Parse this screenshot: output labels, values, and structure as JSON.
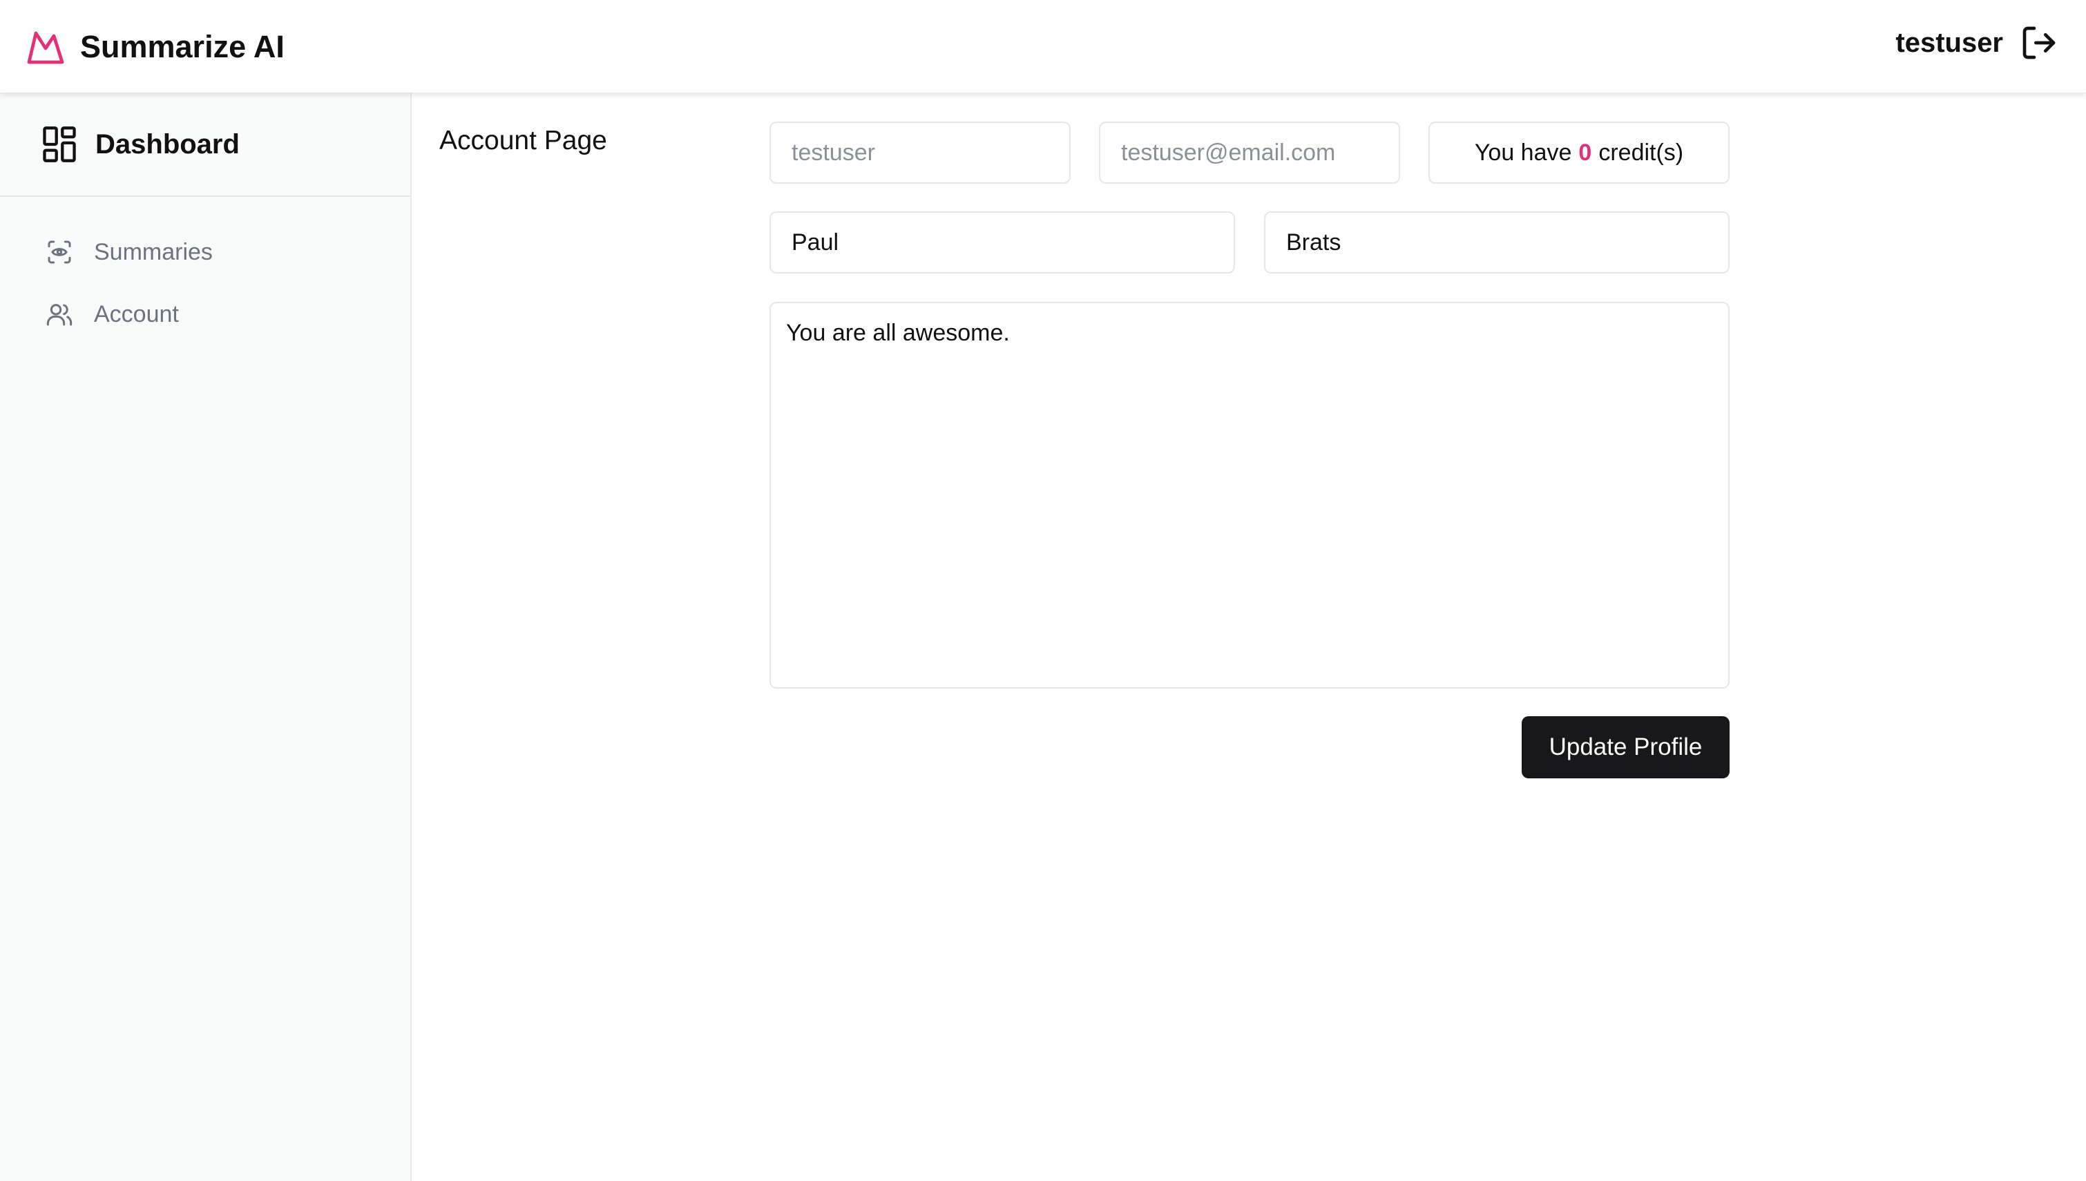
{
  "app": {
    "title": "Summarize AI",
    "brand_color": "#e3307a"
  },
  "header": {
    "username": "testuser",
    "logout_icon": "logout-icon"
  },
  "sidebar": {
    "dashboard_label": "Dashboard",
    "dashboard_icon": "dashboard-grid-icon",
    "items": [
      {
        "label": "Summaries",
        "icon": "eye-icon"
      },
      {
        "label": "Account",
        "icon": "users-icon"
      }
    ]
  },
  "main": {
    "page_title": "Account Page",
    "username_field": {
      "value": "testuser"
    },
    "email_field": {
      "value": "testuser@email.com"
    },
    "credits": {
      "prefix": "You have",
      "count": "0",
      "suffix": "credit(s)"
    },
    "first_name_field": {
      "value": "Paul"
    },
    "last_name_field": {
      "value": "Brats"
    },
    "bio_field": {
      "value": "You are all awesome."
    },
    "update_button_label": "Update Profile"
  }
}
